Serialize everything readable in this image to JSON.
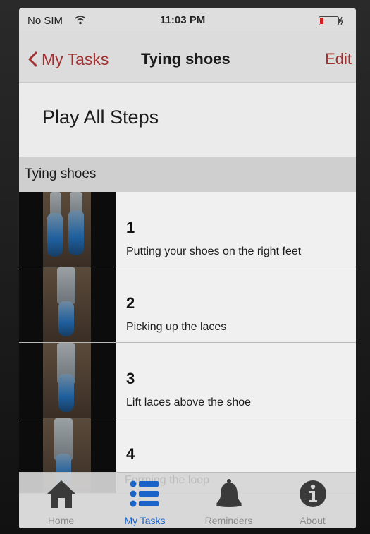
{
  "status_bar": {
    "carrier": "No SIM",
    "time": "11:03 PM"
  },
  "nav": {
    "back_label": "My Tasks",
    "title": "Tying shoes",
    "edit_label": "Edit"
  },
  "play_all": {
    "label": "Play All Steps"
  },
  "section": {
    "title": "Tying shoes"
  },
  "steps": [
    {
      "number": "1",
      "description": "Putting your shoes on the right feet"
    },
    {
      "number": "2",
      "description": "Picking up the laces"
    },
    {
      "number": "3",
      "description": "Lift laces above the shoe"
    },
    {
      "number": "4",
      "description": "Forming the loop"
    }
  ],
  "tabs": [
    {
      "label": "Home",
      "icon": "home-icon",
      "active": false
    },
    {
      "label": "My Tasks",
      "icon": "list-icon",
      "active": true
    },
    {
      "label": "Reminders",
      "icon": "bell-icon",
      "active": false
    },
    {
      "label": "About",
      "icon": "info-icon",
      "active": false
    }
  ],
  "colors": {
    "accent": "#a33030",
    "tab_active": "#1a63c9",
    "tab_inactive": "#8a8a8a"
  }
}
